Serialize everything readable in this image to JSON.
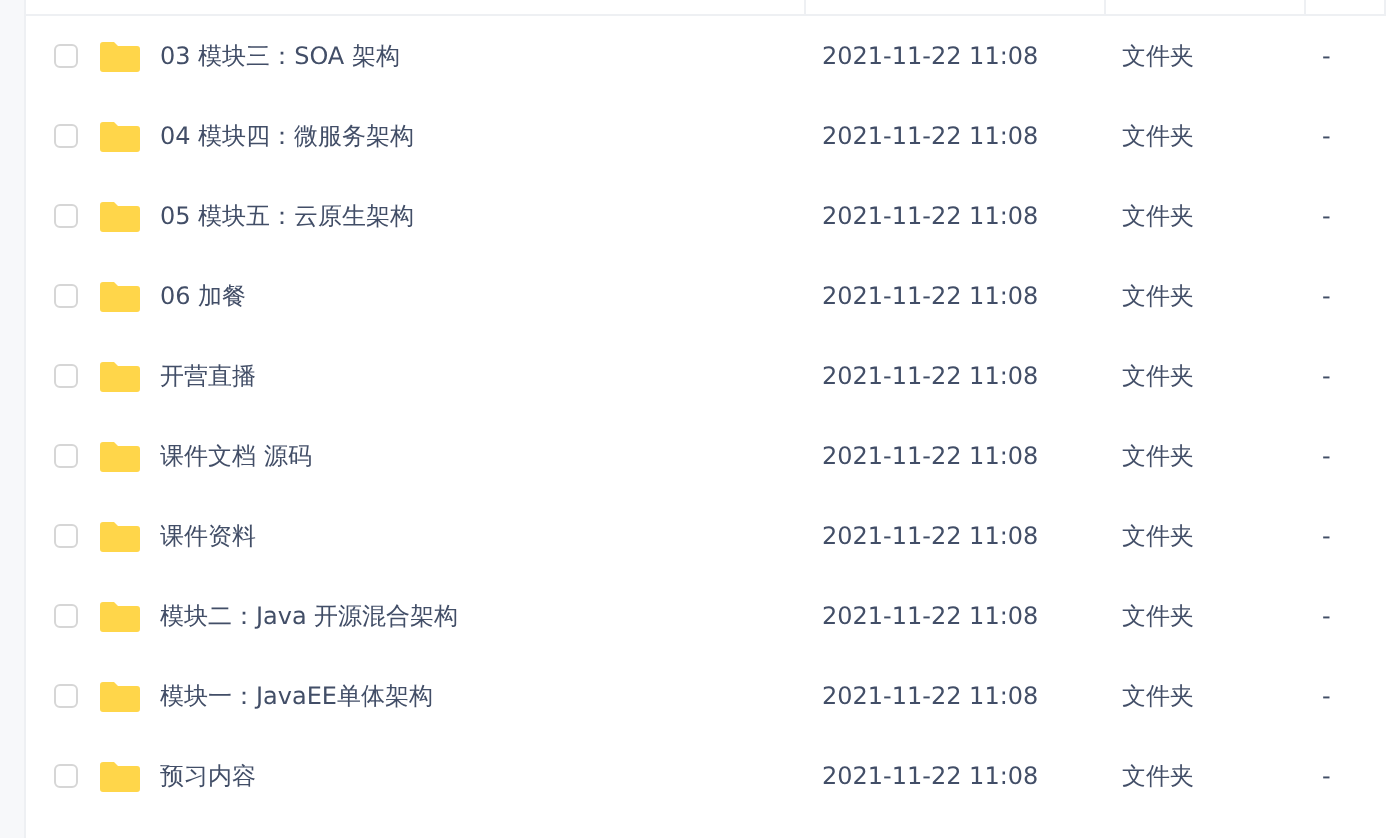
{
  "files": [
    {
      "name": "03 模块三：SOA 架构",
      "modified": "2021-11-22 11:08",
      "type": "文件夹",
      "size": "-",
      "checked": false
    },
    {
      "name": "04 模块四：微服务架构",
      "modified": "2021-11-22 11:08",
      "type": "文件夹",
      "size": "-",
      "checked": false
    },
    {
      "name": "05 模块五：云原生架构",
      "modified": "2021-11-22 11:08",
      "type": "文件夹",
      "size": "-",
      "checked": false
    },
    {
      "name": "06 加餐",
      "modified": "2021-11-22 11:08",
      "type": "文件夹",
      "size": "-",
      "checked": false
    },
    {
      "name": "开营直播",
      "modified": "2021-11-22 11:08",
      "type": "文件夹",
      "size": "-",
      "checked": false
    },
    {
      "name": "课件文档 源码",
      "modified": "2021-11-22 11:08",
      "type": "文件夹",
      "size": "-",
      "checked": false
    },
    {
      "name": "课件资料",
      "modified": "2021-11-22 11:08",
      "type": "文件夹",
      "size": "-",
      "checked": false
    },
    {
      "name": "模块二：Java 开源混合架构",
      "modified": "2021-11-22 11:08",
      "type": "文件夹",
      "size": "-",
      "checked": false
    },
    {
      "name": "模块一：JavaEE单体架构",
      "modified": "2021-11-22 11:08",
      "type": "文件夹",
      "size": "-",
      "checked": false
    },
    {
      "name": "预习内容",
      "modified": "2021-11-22 11:08",
      "type": "文件夹",
      "size": "-",
      "checked": false
    }
  ]
}
